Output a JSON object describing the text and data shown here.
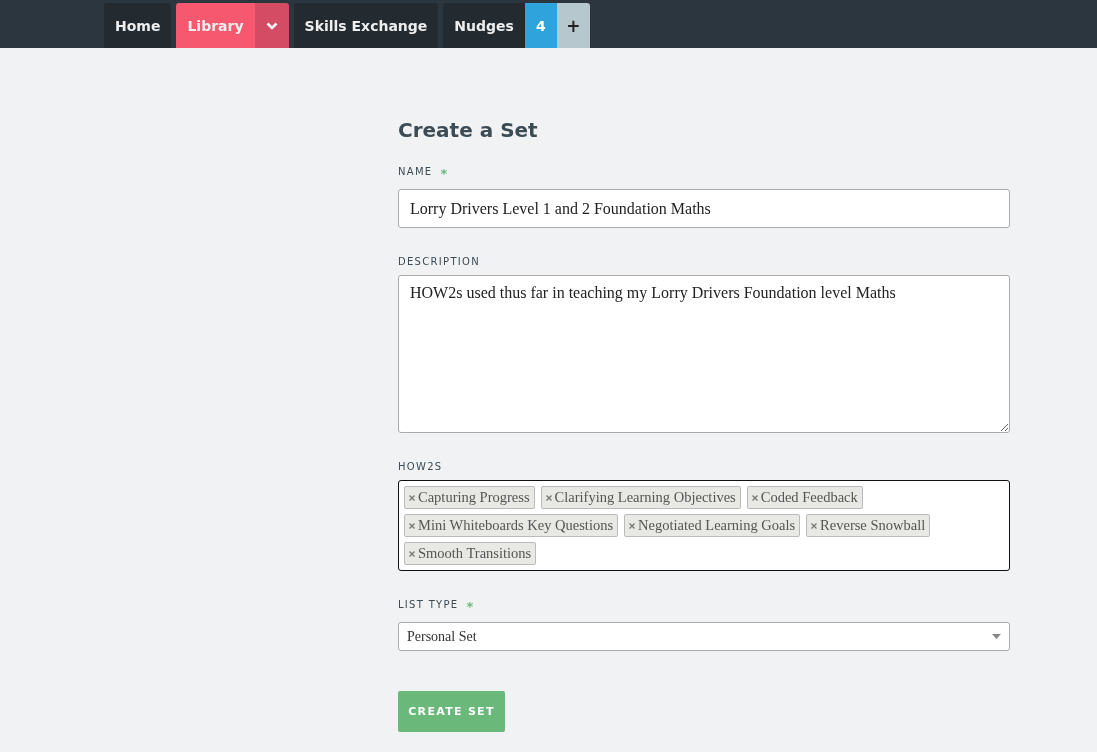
{
  "nav": {
    "tabs": [
      {
        "label": "Home",
        "selected": false
      },
      {
        "label": "Library",
        "selected": true,
        "dropdown": true
      },
      {
        "label": "Skills Exchange",
        "selected": false
      },
      {
        "label": "Nudges",
        "selected": false,
        "badge": "4",
        "add": "+"
      }
    ]
  },
  "form": {
    "title": "Create a Set",
    "name": {
      "label": "NAME",
      "required_mark": "*",
      "value": "Lorry Drivers Level 1 and 2 Foundation Maths"
    },
    "description": {
      "label": "DESCRIPTION",
      "value": "HOW2s used thus far in teaching my Lorry Drivers Foundation level Maths"
    },
    "how2s": {
      "label": "HOW2S",
      "tags": [
        "Capturing Progress",
        "Clarifying Learning Objectives",
        "Coded Feedback",
        "Mini Whiteboards Key Questions",
        "Negotiated Learning Goals",
        "Reverse Snowball",
        "Smooth Transitions"
      ]
    },
    "list_type": {
      "label": "LIST TYPE",
      "required_mark": "*",
      "value": "Personal Set"
    },
    "submit": "CREATE SET"
  }
}
